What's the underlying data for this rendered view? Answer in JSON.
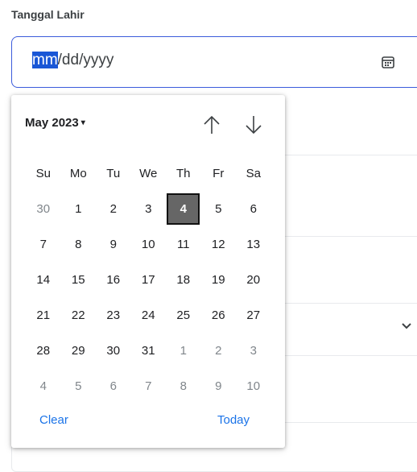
{
  "form": {
    "label": "Tanggal Lahir",
    "input": {
      "segment_month": "mm",
      "rest": "/dd/yyyy"
    }
  },
  "icons": {
    "calendar": "calendar-icon",
    "up": "arrow-up-icon",
    "down": "arrow-down-icon",
    "chevron": "chevron-down-icon"
  },
  "picker": {
    "month_label": "May 2023",
    "caret": "▾",
    "weekdays": [
      "Su",
      "Mo",
      "Tu",
      "We",
      "Th",
      "Fr",
      "Sa"
    ],
    "weeks": [
      [
        "30",
        "1",
        "2",
        "3",
        "4",
        "5",
        "6"
      ],
      [
        "7",
        "8",
        "9",
        "10",
        "11",
        "12",
        "13"
      ],
      [
        "14",
        "15",
        "16",
        "17",
        "18",
        "19",
        "20"
      ],
      [
        "21",
        "22",
        "23",
        "24",
        "25",
        "26",
        "27"
      ],
      [
        "28",
        "29",
        "30",
        "31",
        "1",
        "2",
        "3"
      ],
      [
        "4",
        "5",
        "6",
        "7",
        "8",
        "9",
        "10"
      ]
    ],
    "selected_day": "4",
    "clear_label": "Clear",
    "today_label": "Today"
  },
  "colors": {
    "accent": "#1a73e8",
    "input_border": "#3b5bdb",
    "selection": "#1a57d6",
    "selected_day_bg": "#666666"
  }
}
